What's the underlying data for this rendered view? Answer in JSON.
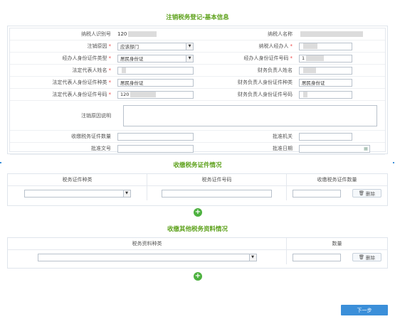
{
  "titles": {
    "basic_info": "注销税务登记-基本信息",
    "certificates": "收缴税务证件情况",
    "other_materials": "收缴其他税务资料情况"
  },
  "form": {
    "taxpayer_id": {
      "label": "纳税人识别号",
      "value": "120"
    },
    "taxpayer_name": {
      "label": "纳税人名称",
      "value": ""
    },
    "reason": {
      "label": "注销原因",
      "required": "*",
      "value": "应该部门"
    },
    "handler": {
      "label": "纳税人经办人",
      "required": "*",
      "value": ""
    },
    "handler_id_type": {
      "label": "经办人身份证件类型",
      "required": "*",
      "value": "居民身份证"
    },
    "handler_id_no": {
      "label": "经办人身份证件号码",
      "required": "*",
      "value": "1"
    },
    "legal_rep_name": {
      "label": "法定代表人姓名",
      "required": "*",
      "value": ""
    },
    "finance_name": {
      "label": "财务负责人姓名",
      "value": ""
    },
    "legal_rep_id_type": {
      "label": "法定代表人身份证件种类",
      "required": "*",
      "value": "居民身份证"
    },
    "finance_id_type": {
      "label": "财务负责人身份证件种类",
      "value": "居民身份证"
    },
    "legal_rep_id_no": {
      "label": "法定代表人身份证件号码",
      "required": "*",
      "value": "120"
    },
    "finance_id_no": {
      "label": "财务负责人身份证件号码",
      "value": ""
    },
    "reason_desc": {
      "label": "注销原因说明"
    },
    "cert_count": {
      "label": "收缴税务证件数量"
    },
    "approval_org": {
      "label": "批准机关"
    },
    "approval_doc": {
      "label": "批准文号"
    },
    "approval_date": {
      "label": "批准日期"
    }
  },
  "cert_table": {
    "headers": [
      "税务证件种类",
      "税务证件号码",
      "收缴税务证件数量"
    ],
    "delete_label": "删除"
  },
  "materials_table": {
    "headers": [
      "税务资料种类",
      "数量"
    ],
    "delete_label": "删除"
  },
  "buttons": {
    "next": "下一步",
    "add": "+"
  },
  "icons": [
    "chevron-down-icon",
    "calendar-icon",
    "trash-icon",
    "plus-circle-icon"
  ],
  "colors": {
    "title_green": "#5da11b",
    "add_green": "#4db13f",
    "primary_blue": "#3b8fd9"
  }
}
